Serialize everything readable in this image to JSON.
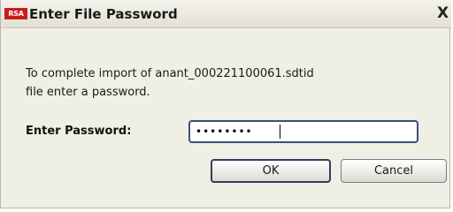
{
  "dialog": {
    "logo_text": "RSA",
    "title": "Enter File Password",
    "close_symbol": "X",
    "message": "To complete import of anant_000221100061.sdtid\nfile enter a password.",
    "password_label": "Enter Password:",
    "password_value": "••••••••",
    "ok_label": "OK",
    "cancel_label": "Cancel"
  },
  "colors": {
    "brand_red": "#c81e1e",
    "dialog_bg": "#f0efe6",
    "focus_border": "#3b4f7a"
  }
}
